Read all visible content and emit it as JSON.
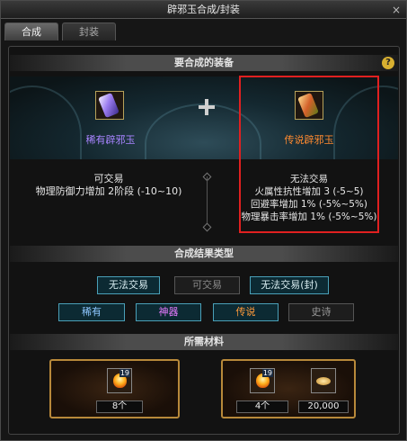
{
  "window": {
    "title": "辟邪玉合成/封装",
    "close_label": "×"
  },
  "tabs": [
    {
      "label": "合成",
      "active": true
    },
    {
      "label": "封装",
      "active": false
    }
  ],
  "sections": {
    "equip": "要合成的装备",
    "result": "合成结果类型",
    "materials": "所需材料",
    "help": "?"
  },
  "items": {
    "left": {
      "name": "稀有辟邪玉",
      "name_color": "#a884ff",
      "trade": "可交易",
      "stats": [
        "物理防御力增加 2阶段 (-10~10)"
      ]
    },
    "right": {
      "name": "传说辟邪玉",
      "name_color": "#ff8a30",
      "trade": "无法交易",
      "stats": [
        "火属性抗性增加 3 (-5~5)",
        "回避率增加 1% (-5%~5%)",
        "物理暴击率增加 1% (-5%~5%)"
      ]
    }
  },
  "result_type": {
    "row1": [
      {
        "label": "无法交易",
        "selected": true
      },
      {
        "label": "可交易",
        "selected": false
      },
      {
        "label": "无法交易(封)",
        "selected": true
      }
    ],
    "row2": [
      {
        "label": "稀有",
        "selected": true
      },
      {
        "label": "神器",
        "selected": true
      },
      {
        "label": "传说",
        "selected": true
      },
      {
        "label": "史诗",
        "selected": false
      }
    ]
  },
  "materials": {
    "left": {
      "stack": "19",
      "count": "8个"
    },
    "right": {
      "stack": "19",
      "count": "4个",
      "gold": "20,000"
    }
  }
}
